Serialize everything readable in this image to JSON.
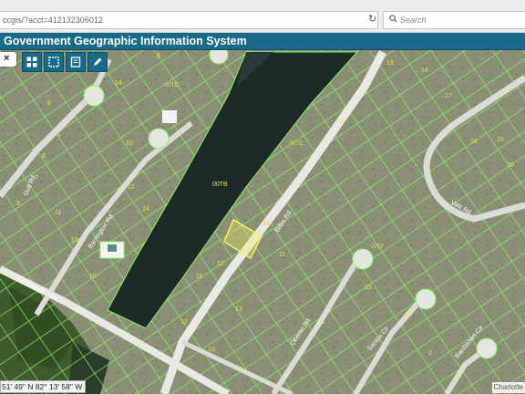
{
  "browser": {
    "url": "ccgis/?acct=412132306012",
    "search_placeholder": "Search"
  },
  "app": {
    "title": "Government Geographic Information System"
  },
  "toolbar": {
    "close_label": "×",
    "tools": [
      "grid-icon",
      "select-area-icon",
      "document-icon",
      "pencil-icon"
    ]
  },
  "map": {
    "water_parcel_label": "00TB",
    "roads": [
      "Gull Rd",
      "Barrington Rd",
      "Kimbrough Blvd",
      "Bilbo Rd",
      "Vale Rd",
      "Oberlin Rd",
      "Santos Cir",
      "Bardstown Cir"
    ],
    "lot_numbers_left": [
      "8",
      "14",
      "12",
      "10",
      "5",
      "6",
      "7",
      "9",
      "11",
      "13",
      "10",
      "8",
      "11",
      "12",
      "13",
      "14"
    ],
    "lot_numbers_right": [
      "13",
      "14",
      "15",
      "16",
      "13",
      "12",
      "11",
      "10",
      "17",
      "18",
      "19",
      "20",
      "4",
      "3",
      "2",
      "1"
    ],
    "selected_parcel_label": "13",
    "water_labels": [
      "00TE",
      "00TC",
      "00TF"
    ]
  },
  "status": {
    "coordinates": "51' 49\" N 82° 13' 58\" W",
    "attribution": "Charlotte"
  },
  "colors": {
    "header": "#1a6a89",
    "parcel_lines": "#8ff36a",
    "lot_numbers": "#e8e44a",
    "selection": "#f2f060",
    "canal": "#1e2a28"
  }
}
